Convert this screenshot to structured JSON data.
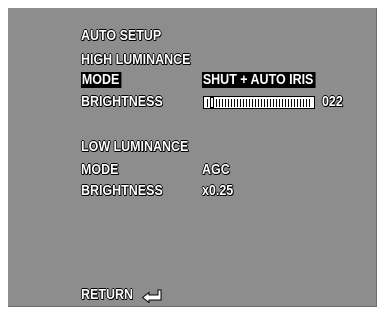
{
  "menu": {
    "title": "AUTO SETUP",
    "high_luminance": {
      "heading": "HIGH LUMINANCE",
      "mode_label": "MODE",
      "mode_value": "SHUT + AUTO IRIS",
      "brightness_label": "BRIGHTNESS",
      "brightness_value": "022",
      "brightness_level": 0.06
    },
    "low_luminance": {
      "heading": "LOW LUMINANCE",
      "mode_label": "MODE",
      "mode_value": "AGC",
      "brightness_label": "BRIGHTNESS",
      "brightness_value": "x0.25"
    },
    "return_label": "RETURN",
    "return_icon": "enter-arrow-icon"
  },
  "colors": {
    "background": "#8d8d8d",
    "text": "#ffffff",
    "highlight": "#000000"
  }
}
